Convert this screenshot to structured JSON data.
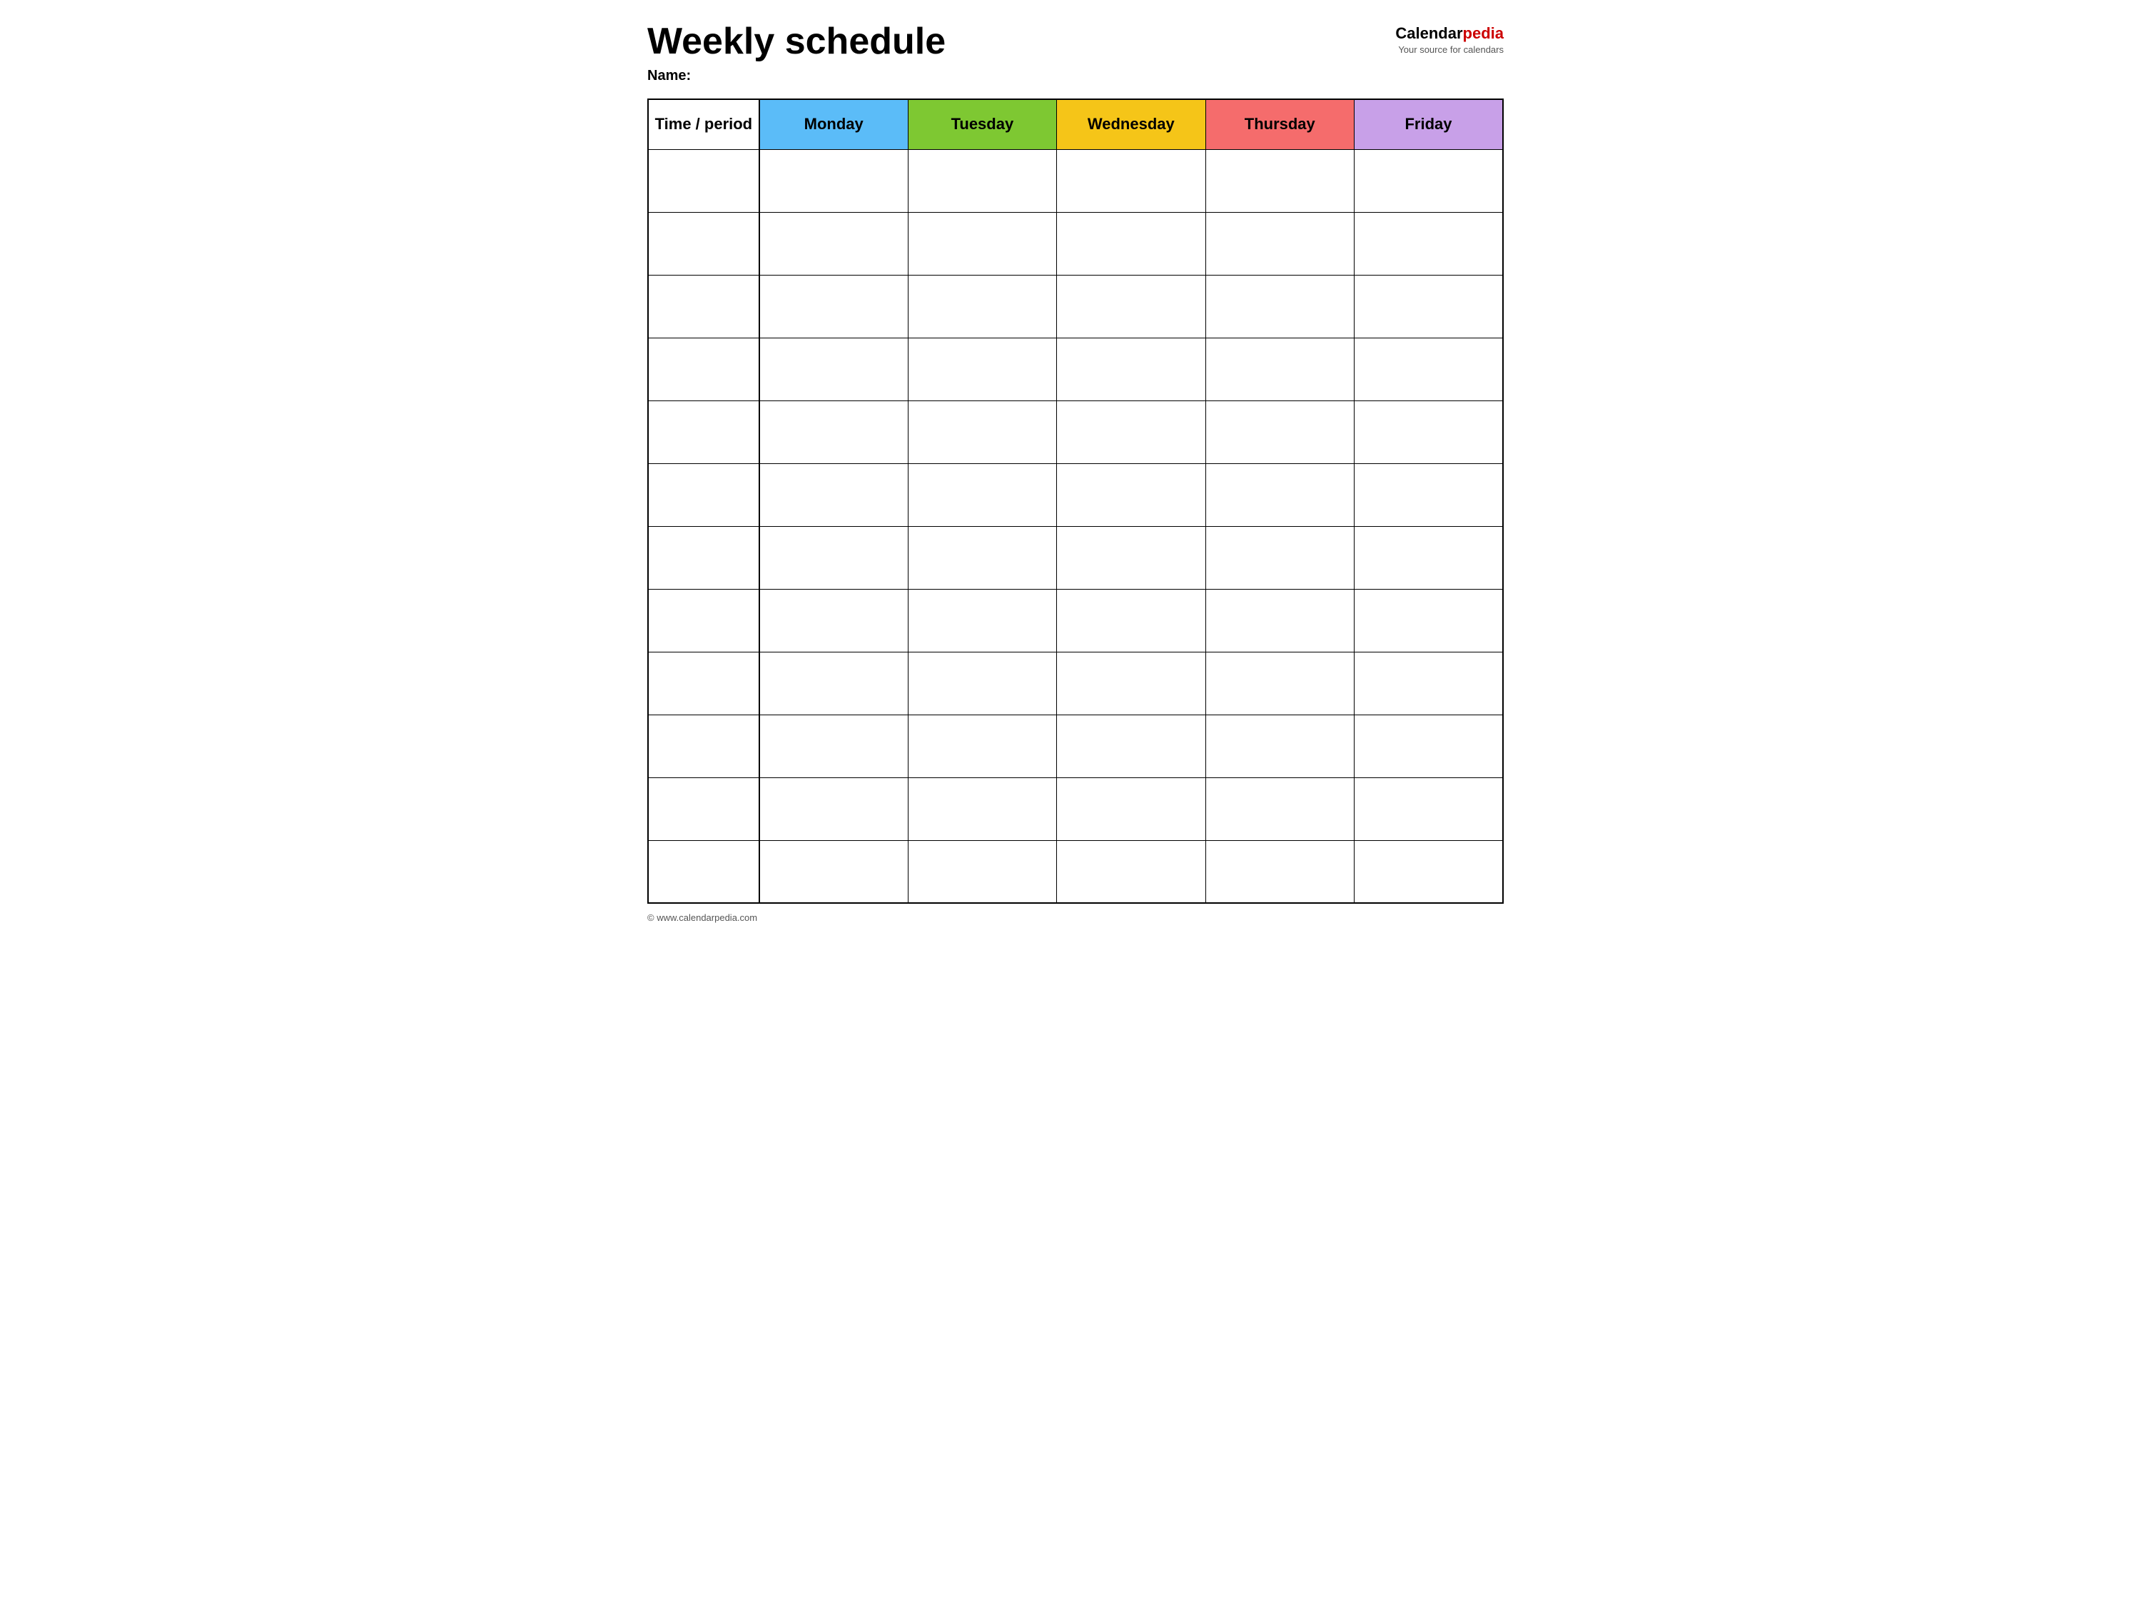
{
  "header": {
    "title": "Weekly schedule",
    "name_label": "Name:",
    "logo_calendar": "Calendar",
    "logo_pedia": "pedia",
    "logo_tagline": "Your source for calendars"
  },
  "table": {
    "columns": [
      {
        "id": "time",
        "label": "Time / period",
        "class": "time-header"
      },
      {
        "id": "monday",
        "label": "Monday",
        "class": "monday-header"
      },
      {
        "id": "tuesday",
        "label": "Tuesday",
        "class": "tuesday-header"
      },
      {
        "id": "wednesday",
        "label": "Wednesday",
        "class": "wednesday-header"
      },
      {
        "id": "thursday",
        "label": "Thursday",
        "class": "thursday-header"
      },
      {
        "id": "friday",
        "label": "Friday",
        "class": "friday-header"
      }
    ],
    "row_count": 12
  },
  "footer": {
    "copyright": "© www.calendarpedia.com"
  }
}
